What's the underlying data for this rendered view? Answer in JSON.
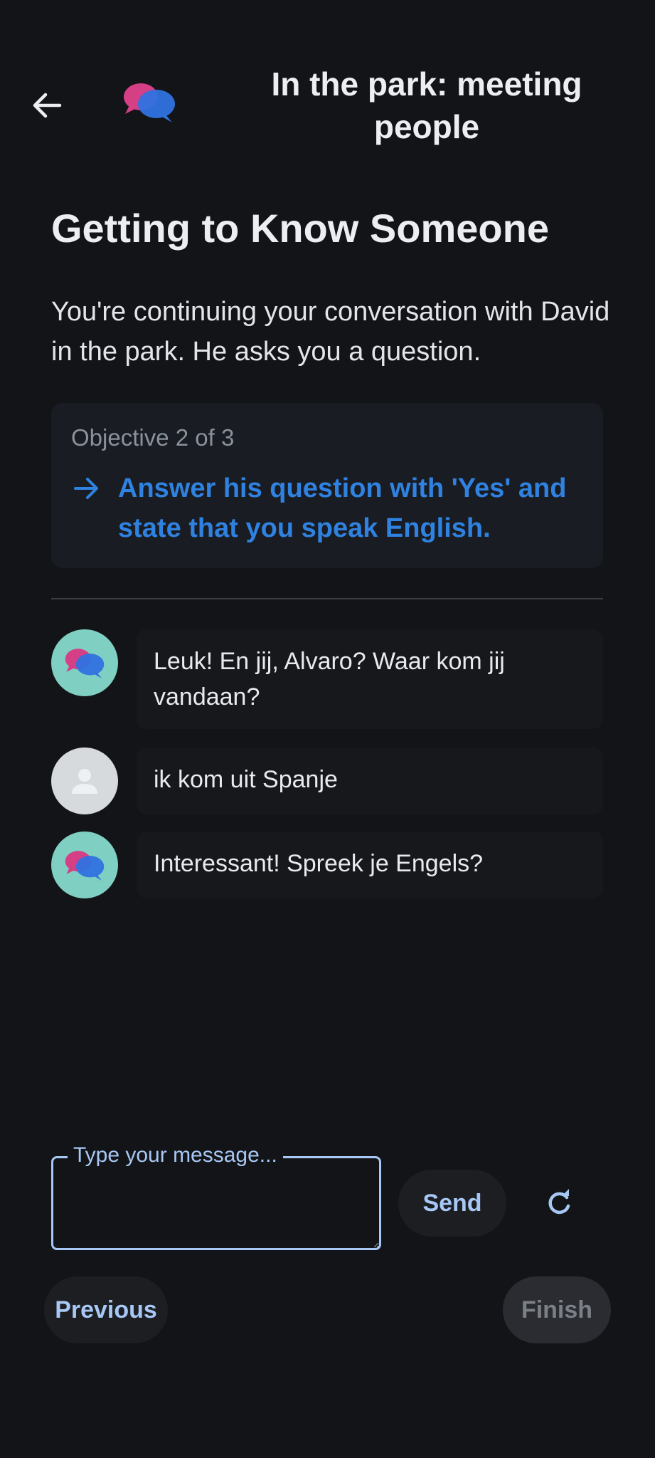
{
  "header": {
    "title": "In the park: meeting people",
    "back_icon": "arrow-left-icon",
    "logo_icon": "chat-bubbles-logo"
  },
  "scenario": {
    "title": "Getting to Know Someone",
    "description": "You're continuing your conversation with David in the park. He asks you a question."
  },
  "objective": {
    "counter": "Objective 2 of 3",
    "text": "Answer his question with 'Yes' and state that you speak English.",
    "accent_color": "#2f82e0"
  },
  "messages": [
    {
      "sender": "bot",
      "text": "Leuk! En jij, Alvaro? Waar kom jij vandaan?"
    },
    {
      "sender": "user",
      "text": "ik kom uit Spanje"
    },
    {
      "sender": "bot",
      "text": "Interessant! Spreek je Engels?"
    }
  ],
  "composer": {
    "placeholder_label": "Type your message...",
    "value": "",
    "send_label": "Send",
    "refresh_icon": "refresh-icon"
  },
  "navigation": {
    "previous_label": "Previous",
    "finish_label": "Finish"
  },
  "colors": {
    "background": "#131417",
    "accent": "#a7c8f5",
    "bot_avatar": "#7fcfc3",
    "user_avatar": "#d7dadc"
  }
}
